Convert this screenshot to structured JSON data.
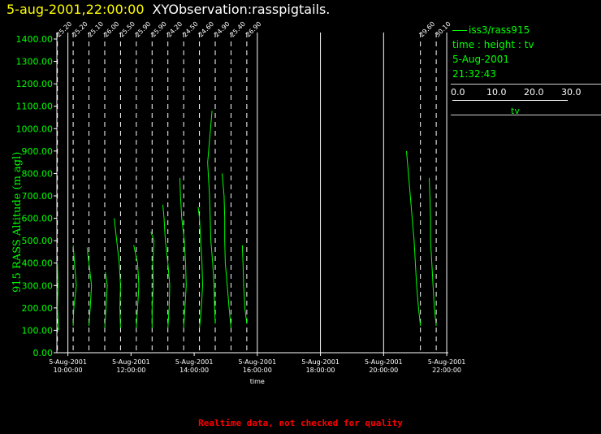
{
  "header": {
    "date_time": "5-aug-2001,22:00:00",
    "observation": "XYObservation:rasspigtails."
  },
  "legend": {
    "series": "iss3/rass915",
    "axes": "time : height : tv",
    "date": "5-Aug-2001",
    "time": "21:32:43",
    "scale_ticks": [
      "0.0",
      "10.0",
      "20.0",
      "30.0"
    ],
    "scale_label": "tv"
  },
  "footer": {
    "note": "Realtime data, not checked for quality"
  },
  "colors": {
    "background": "#000000",
    "series": "#00ff00",
    "title_date": "#ffff00",
    "footer": "#ff0000",
    "axis": "#ffffff"
  },
  "chart_data": {
    "type": "line",
    "title": "5-aug-2001,22:00:00 XYObservation:rasspigtails.",
    "xlabel": "time",
    "ylabel": "915 RASS Altitude (m agl)",
    "ylim": [
      0,
      1400
    ],
    "y_ticks": [
      "0.00",
      "100.00",
      "200.00",
      "300.00",
      "400.00",
      "500.00",
      "600.00",
      "700.00",
      "800.00",
      "900.00",
      "1000.00",
      "1100.00",
      "1200.00",
      "1300.00",
      "1400.00"
    ],
    "x_ticks": [
      {
        "date": "5-Aug-2001",
        "time": "10:00:00"
      },
      {
        "date": "5-Aug-2001",
        "time": "12:00:00"
      },
      {
        "date": "5-Aug-2001",
        "time": "14:00:00"
      },
      {
        "date": "5-Aug-2001",
        "time": "16:00:00"
      },
      {
        "date": "5-Aug-2001",
        "time": "18:00:00"
      },
      {
        "date": "5-Aug-2001",
        "time": "20:00:00"
      },
      {
        "date": "5-Aug-2001",
        "time": "22:00:00"
      }
    ],
    "xlim_hours": [
      9.65,
      22.05
    ],
    "grid_hours": [
      10,
      16,
      18,
      20,
      22
    ],
    "tv_scale": [
      0,
      30
    ],
    "profiles": [
      {
        "time": 9.667,
        "label": "25.20",
        "points": [
          [
            100,
            0.2
          ],
          [
            200,
            0.0
          ],
          [
            300,
            0.1
          ],
          [
            400,
            0.0
          ]
        ]
      },
      {
        "time": 10.167,
        "label": "25.20",
        "points": [
          [
            120,
            0.0
          ],
          [
            200,
            0.1
          ],
          [
            300,
            0.5
          ],
          [
            400,
            0.2
          ],
          [
            480,
            0.0
          ]
        ]
      },
      {
        "time": 10.667,
        "label": "25.10",
        "points": [
          [
            120,
            0.0
          ],
          [
            200,
            0.2
          ],
          [
            300,
            0.4
          ],
          [
            400,
            0.0
          ],
          [
            470,
            -0.3
          ]
        ]
      },
      {
        "time": 11.167,
        "label": "26.00",
        "points": [
          [
            110,
            0.0
          ],
          [
            200,
            0.2
          ],
          [
            300,
            0.4
          ],
          [
            360,
            0.1
          ]
        ]
      },
      {
        "time": 11.667,
        "label": "25.50",
        "points": [
          [
            110,
            0.0
          ],
          [
            200,
            -0.1
          ],
          [
            300,
            0.0
          ],
          [
            400,
            -0.2
          ],
          [
            500,
            -0.6
          ],
          [
            600,
            -1.0
          ]
        ]
      },
      {
        "time": 12.167,
        "label": "25.90",
        "points": [
          [
            110,
            0.0
          ],
          [
            200,
            0.2
          ],
          [
            300,
            0.4
          ],
          [
            400,
            0.2
          ],
          [
            480,
            -0.4
          ]
        ]
      },
      {
        "time": 12.667,
        "label": "25.90",
        "points": [
          [
            110,
            0.0
          ],
          [
            200,
            0.0
          ],
          [
            300,
            0.2
          ],
          [
            400,
            0.1
          ],
          [
            500,
            0.3
          ],
          [
            540,
            -0.2
          ]
        ]
      },
      {
        "time": 13.167,
        "label": "24.20",
        "points": [
          [
            110,
            0.0
          ],
          [
            200,
            0.2
          ],
          [
            300,
            0.3
          ],
          [
            400,
            0.0
          ],
          [
            500,
            -0.4
          ],
          [
            600,
            -0.6
          ],
          [
            660,
            -0.8
          ]
        ]
      },
      {
        "time": 13.667,
        "label": "24.50",
        "points": [
          [
            110,
            0.0
          ],
          [
            200,
            0.2
          ],
          [
            300,
            0.4
          ],
          [
            400,
            0.3
          ],
          [
            500,
            0.1
          ],
          [
            600,
            -0.3
          ],
          [
            700,
            -0.5
          ],
          [
            780,
            -0.6
          ]
        ]
      },
      {
        "time": 14.167,
        "label": "24.60",
        "points": [
          [
            110,
            0.0
          ],
          [
            200,
            0.3
          ],
          [
            300,
            0.5
          ],
          [
            400,
            0.4
          ],
          [
            500,
            0.2
          ],
          [
            600,
            0.0
          ],
          [
            650,
            -0.2
          ]
        ]
      },
      {
        "time": 14.667,
        "label": "24.90",
        "points": [
          [
            130,
            0.0
          ],
          [
            200,
            -0.1
          ],
          [
            300,
            -0.2
          ],
          [
            400,
            -0.4
          ],
          [
            500,
            -0.7
          ],
          [
            600,
            -0.8
          ],
          [
            700,
            -0.9
          ],
          [
            800,
            -1.1
          ],
          [
            850,
            -1.2
          ],
          [
            1080,
            -0.5
          ]
        ]
      },
      {
        "time": 15.167,
        "label": "25.40",
        "points": [
          [
            110,
            0.0
          ],
          [
            200,
            -0.3
          ],
          [
            300,
            -0.6
          ],
          [
            400,
            -0.9
          ],
          [
            500,
            -1.0
          ],
          [
            600,
            -1.0
          ],
          [
            700,
            -1.1
          ],
          [
            800,
            -1.4
          ]
        ]
      },
      {
        "time": 15.667,
        "label": "26.90",
        "points": [
          [
            130,
            0.0
          ],
          [
            200,
            -0.3
          ],
          [
            300,
            -0.5
          ],
          [
            400,
            -0.6
          ],
          [
            480,
            -0.7
          ]
        ]
      },
      {
        "time": 21.167,
        "label": "29.60",
        "points": [
          [
            120,
            0.0
          ],
          [
            200,
            -0.3
          ],
          [
            300,
            -0.6
          ],
          [
            400,
            -0.8
          ],
          [
            500,
            -1.0
          ],
          [
            600,
            -1.3
          ],
          [
            700,
            -1.6
          ],
          [
            800,
            -1.9
          ],
          [
            900,
            -2.2
          ]
        ]
      },
      {
        "time": 21.667,
        "label": "30.10",
        "points": [
          [
            120,
            0.0
          ],
          [
            200,
            -0.3
          ],
          [
            300,
            -0.5
          ],
          [
            400,
            -0.7
          ],
          [
            500,
            -0.9
          ],
          [
            600,
            -0.9
          ],
          [
            700,
            -1.0
          ],
          [
            780,
            -1.1
          ]
        ]
      }
    ]
  }
}
